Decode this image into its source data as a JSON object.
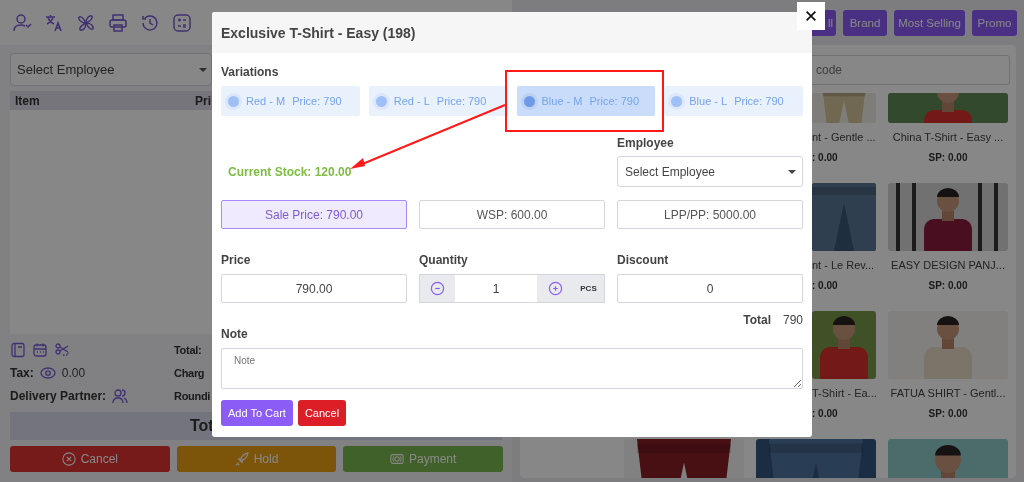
{
  "left_panel": {
    "employee_select": {
      "value": "Select Employee"
    },
    "cart_columns": [
      "Item",
      "Pri"
    ],
    "summary": {
      "total_label": "Total:",
      "tax_label": "Tax:",
      "tax_value": "0.00",
      "charge_label": "Charg",
      "delivery_partner_label": "Delivery Partner:",
      "rounding_label": "Roundi",
      "grand_total_label": "Tot"
    },
    "actions": [
      {
        "kind": "cancel",
        "label": "Cancel"
      },
      {
        "kind": "hold",
        "label": "Hold"
      },
      {
        "kind": "payment",
        "label": "Payment"
      }
    ]
  },
  "right_panel": {
    "categories": [
      "ll",
      "Brand",
      "Most Selling",
      "Promo"
    ],
    "search": {
      "placeholder": "code"
    },
    "products": [
      {
        "name": "nt - Gentle ...",
        "price": ": 0.00"
      },
      {
        "name": "China T-Shirt - Easy ...",
        "price": "SP: 0.00"
      },
      {
        "name": "nt - Le Rev...",
        "price": ": 0.00"
      },
      {
        "name": "EASY DESIGN PANJ...",
        "price": "SP: 0.00"
      },
      {
        "name": "T-Shirt - Ea...",
        "price": ": 0.00"
      },
      {
        "name": "FATUA SHIRT - Gentl...",
        "price": "SP: 0.00"
      },
      {
        "kind": "picture"
      },
      {
        "kind": "picture"
      },
      {
        "kind": "picture"
      }
    ]
  },
  "dialog": {
    "title": "Exclusive T-Shirt - Easy (198)",
    "variations_label": "Variations",
    "variations": [
      {
        "name": "Red - M",
        "price": "Price: 790",
        "selected": false
      },
      {
        "name": "Red - L",
        "price": "Price: 790",
        "selected": false
      },
      {
        "name": "Blue - M",
        "price": "Price: 790",
        "selected": true
      },
      {
        "name": "Blue - L",
        "price": "Price: 790",
        "selected": false
      }
    ],
    "current_stock": "Current Stock: 120.00",
    "employee_label": "Employee",
    "employee_select": {
      "value": "Select Employee"
    },
    "price_options": [
      {
        "label": "Sale Price: 790.00",
        "selected": true
      },
      {
        "label": "WSP: 600.00",
        "selected": false
      },
      {
        "label": "LPP/PP: 5000.00",
        "selected": false
      }
    ],
    "price_label": "Price",
    "price_value": "790.00",
    "quantity_label": "Quantity",
    "quantity_value": "1",
    "unit": "PCS",
    "discount_label": "Discount",
    "discount_value": "0",
    "total_label": "Total",
    "total_value": "790",
    "note_label": "Note",
    "note": {
      "placeholder": "Note"
    },
    "buttons": [
      {
        "kind": "primary",
        "label": "Add To Cart"
      },
      {
        "kind": "danger",
        "label": "Cancel"
      }
    ]
  }
}
